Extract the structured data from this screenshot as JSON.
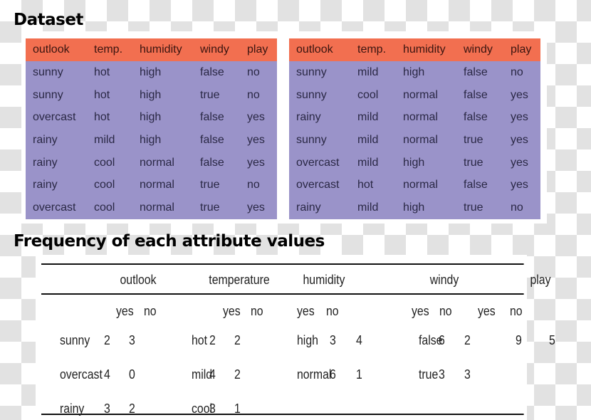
{
  "headings": {
    "dataset": "Dataset",
    "frequency": "Frequency of each attribute values"
  },
  "colors": {
    "header_bg": "#f26f50",
    "body_bg": "#9a93c9",
    "checker_gray": "#e2e2e2"
  },
  "dataset": {
    "columns": [
      "outlook",
      "temp.",
      "humidity",
      "windy",
      "play"
    ],
    "left_rows": [
      [
        "sunny",
        "hot",
        "high",
        "false",
        "no"
      ],
      [
        "sunny",
        "hot",
        "high",
        "true",
        "no"
      ],
      [
        "overcast",
        "hot",
        "high",
        "false",
        "yes"
      ],
      [
        "rainy",
        "mild",
        "high",
        "false",
        "yes"
      ],
      [
        "rainy",
        "cool",
        "normal",
        "false",
        "yes"
      ],
      [
        "rainy",
        "cool",
        "normal",
        "true",
        "no"
      ],
      [
        "overcast",
        "cool",
        "normal",
        "true",
        "yes"
      ]
    ],
    "right_rows": [
      [
        "sunny",
        "mild",
        "high",
        "false",
        "no"
      ],
      [
        "sunny",
        "cool",
        "normal",
        "false",
        "yes"
      ],
      [
        "rainy",
        "mild",
        "normal",
        "false",
        "yes"
      ],
      [
        "sunny",
        "mild",
        "normal",
        "true",
        "yes"
      ],
      [
        "overcast",
        "mild",
        "high",
        "true",
        "yes"
      ],
      [
        "overcast",
        "hot",
        "normal",
        "false",
        "yes"
      ],
      [
        "rainy",
        "mild",
        "high",
        "true",
        "no"
      ]
    ]
  },
  "frequency": {
    "groups": [
      {
        "name": "outlook",
        "sub": [
          "yes",
          "no"
        ],
        "rows": [
          [
            "sunny",
            "2",
            "3"
          ],
          [
            "overcast",
            "4",
            "0"
          ],
          [
            "rainy",
            "3",
            "2"
          ]
        ]
      },
      {
        "name": "temperature",
        "sub": [
          "yes",
          "no"
        ],
        "rows": [
          [
            "hot",
            "2",
            "2"
          ],
          [
            "mild",
            "4",
            "2"
          ],
          [
            "cool",
            "3",
            "1"
          ]
        ]
      },
      {
        "name": "humidity",
        "sub": [
          "yes",
          "no"
        ],
        "rows": [
          [
            "high",
            "3",
            "4"
          ],
          [
            "normal",
            "6",
            "1"
          ]
        ]
      },
      {
        "name": "windy",
        "sub": [
          "yes",
          "no"
        ],
        "rows": [
          [
            "false",
            "6",
            "2"
          ],
          [
            "true",
            "3",
            "3"
          ]
        ]
      },
      {
        "name": "play",
        "sub": [
          "yes",
          "no"
        ],
        "rows": [
          [
            "",
            "9",
            "5"
          ]
        ]
      }
    ]
  }
}
